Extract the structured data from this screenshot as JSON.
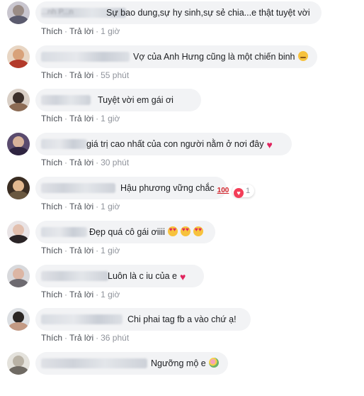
{
  "comments": [
    {
      "author_partial": "...nh P...n",
      "text": "Sự bao dung,sự hy sinh,sự sẻ chia...e thật tuyệt vời",
      "emoji": "",
      "time": "1 giờ",
      "colors": [
        "#c9c6cf",
        "#9a8c86",
        "#5b5b6e"
      ]
    },
    {
      "author_partial": "",
      "text": "Vợ của Anh Hưng cũng là một chiến binh",
      "emoji": "smirk",
      "time": "55 phút",
      "colors": [
        "#e8d6c4",
        "#d8a27a",
        "#b33a2a"
      ]
    },
    {
      "author_partial": "",
      "text": "Tuyệt vời em gái ơi",
      "emoji": "",
      "time": "1 giờ",
      "colors": [
        "#d9cfc6",
        "#3b2f2a",
        "#8c6b54"
      ]
    },
    {
      "author_partial": "",
      "text": "giá trị cao nhất của con người nằm ở nơi đây",
      "emoji": "heart",
      "time": "30 phút",
      "colors": [
        "#5a4b6e",
        "#d7b29a",
        "#2e2440"
      ]
    },
    {
      "author_partial": "",
      "text": "Hậu phương vững chắc",
      "emoji": "100",
      "time": "1 giờ",
      "reaction_count": "1",
      "colors": [
        "#3a2d22",
        "#e2b88f",
        "#6a5840"
      ]
    },
    {
      "author_partial": "",
      "text": "Đẹp quá cô gái ơiiii",
      "emoji": "hearteyes3",
      "time": "1 giờ",
      "colors": [
        "#e9e4e6",
        "#e2bfae",
        "#2a2426"
      ]
    },
    {
      "author_partial": "",
      "text": "Luôn là c iu của e",
      "emoji": "heart",
      "time": "1 giờ",
      "colors": [
        "#d8d9dc",
        "#dcb6a4",
        "#6d6a70"
      ]
    },
    {
      "author_partial": "",
      "text": "Chi phai tag fb a vào chứ ạ!",
      "emoji": "",
      "time": "36 phút",
      "colors": [
        "#dcdfe3",
        "#2b2624",
        "#c39a84"
      ]
    },
    {
      "author_partial": "",
      "text": "Ngưỡng mộ e",
      "emoji": "flower",
      "time": "",
      "colors": [
        "#e4e2dc",
        "#b9b2a5",
        "#6f6a63"
      ]
    }
  ],
  "actions": {
    "like": "Thích",
    "reply": "Trả lời",
    "separator": "·"
  },
  "accent": {
    "heart": "#e0245e",
    "reaction": "#f33e58",
    "bubble": "#f2f3f5"
  }
}
